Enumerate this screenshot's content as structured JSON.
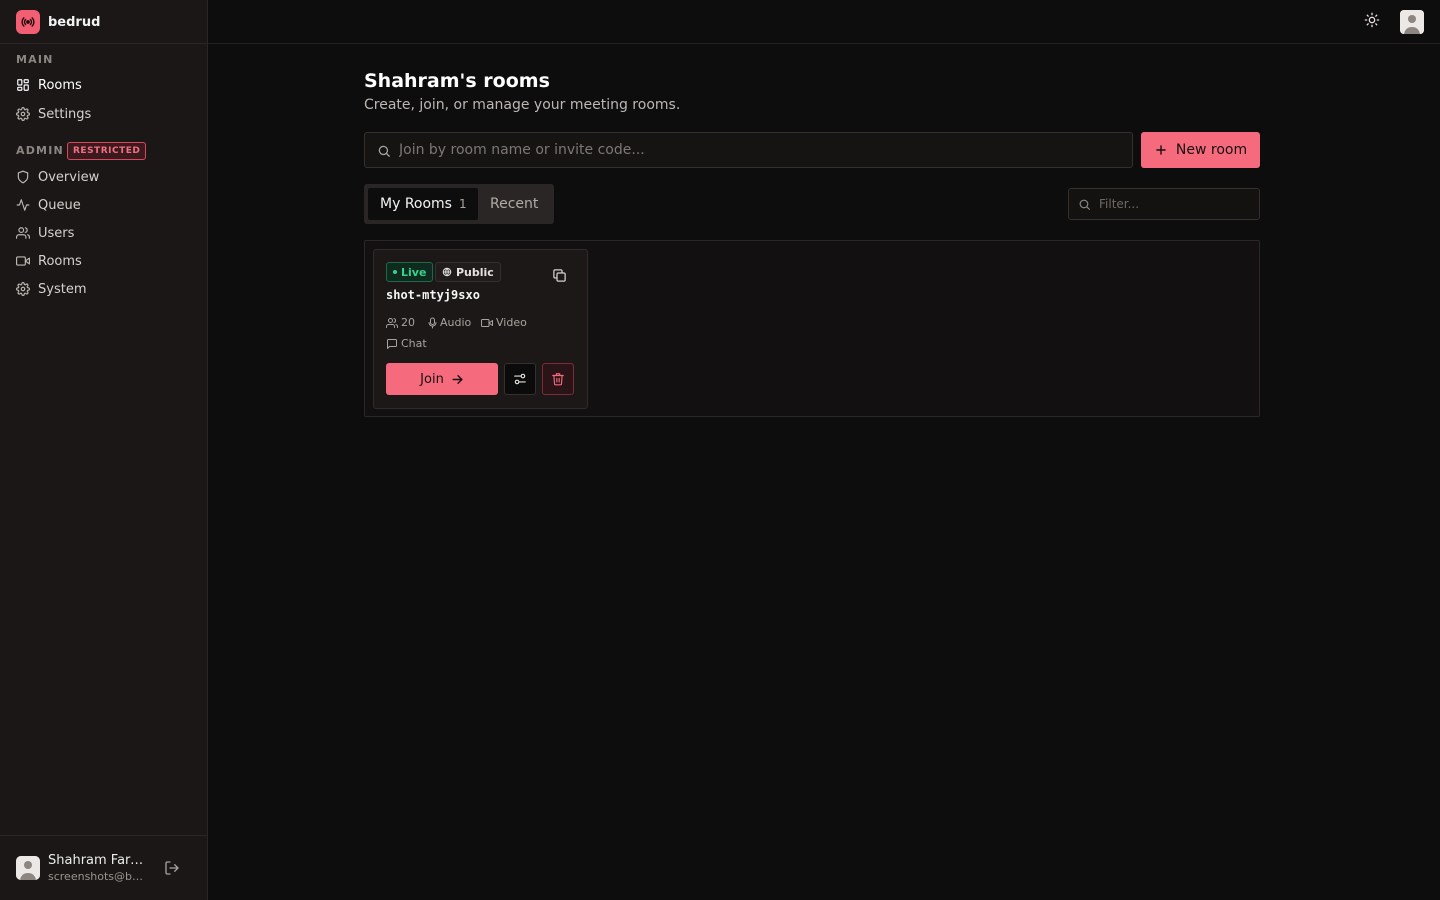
{
  "brand": {
    "name": "bedrud"
  },
  "sidebar": {
    "main_label": "MAIN",
    "main_items": [
      {
        "label": "Rooms",
        "icon": "grid-icon"
      },
      {
        "label": "Settings",
        "icon": "gear-icon"
      }
    ],
    "admin_label": "ADMIN",
    "admin_badge": "RESTRICTED",
    "admin_items": [
      {
        "label": "Overview",
        "icon": "shield-icon"
      },
      {
        "label": "Queue",
        "icon": "activity-icon"
      },
      {
        "label": "Users",
        "icon": "users-icon"
      },
      {
        "label": "Rooms",
        "icon": "video-icon"
      },
      {
        "label": "System",
        "icon": "gear-icon"
      }
    ],
    "user": {
      "name": "Shahram Farh...",
      "email": "screenshots@bed..."
    }
  },
  "header": {
    "theme_icon": "sun-icon",
    "avatar_icon": "avatar-icon"
  },
  "main": {
    "title": "Shahram's rooms",
    "subtitle": "Create, join, or manage your meeting rooms.",
    "join_placeholder": "Join by room name or invite code...",
    "new_room_label": "New room",
    "tabs": [
      {
        "label": "My Rooms",
        "count": "1"
      },
      {
        "label": "Recent"
      }
    ],
    "filter_placeholder": "Filter...",
    "rooms": [
      {
        "status": "Live",
        "visibility": "Public",
        "name": "shot-mtyj9sxo",
        "participants": "20",
        "features": [
          "Audio",
          "Video",
          "Chat"
        ],
        "join_label": "Join"
      }
    ]
  },
  "colors": {
    "accent": "#f56a7d",
    "live": "#35d38c",
    "background": "#0e0d0d",
    "sidebar": "#1a1716"
  }
}
